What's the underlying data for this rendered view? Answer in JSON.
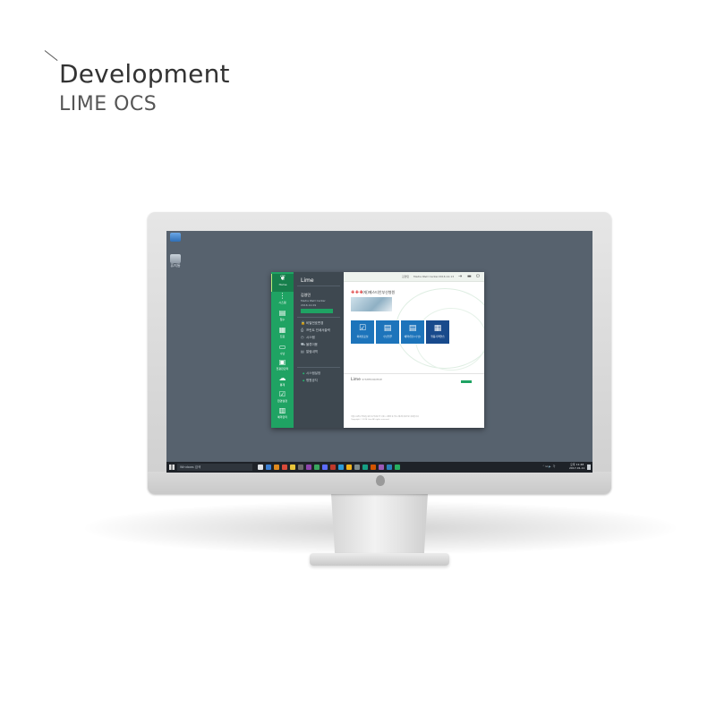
{
  "heading": {
    "title": "Development",
    "subtitle": "LIME OCS"
  },
  "desktop": {
    "icons": [
      {
        "name": "pc-icon",
        "label": ""
      },
      {
        "name": "recycle-bin-icon",
        "label": "휴지통"
      }
    ]
  },
  "app": {
    "rail": [
      {
        "icon": "leaf-icon",
        "label": "Home",
        "active": true
      },
      {
        "icon": "tree-icon",
        "label": "시스템"
      },
      {
        "icon": "clipboard-icon",
        "label": "접수"
      },
      {
        "icon": "document-icon",
        "label": "진료"
      },
      {
        "icon": "card-icon",
        "label": "수납"
      },
      {
        "icon": "monitor-icon",
        "label": "전광판관리"
      },
      {
        "icon": "cloud-icon",
        "label": "통계"
      },
      {
        "icon": "checklist-icon",
        "label": "환경설정"
      },
      {
        "icon": "calendar-icon",
        "label": "예약관리"
      }
    ],
    "sidebar": {
      "brand": "Lime",
      "user_name": "김영민",
      "user_center": "Media R&D Center",
      "user_date": "2016.12.09",
      "user_button": "",
      "menu": [
        {
          "icon": "lock-icon",
          "label": "비밀번호변경"
        },
        {
          "icon": "print-icon",
          "label": "프린트 인쇄서출력"
        },
        {
          "icon": "clock-icon",
          "label": "시스템"
        },
        {
          "icon": "truck-icon",
          "label": "물류이용"
        },
        {
          "icon": "doc-icon",
          "label": "알림내역"
        }
      ],
      "submenu": [
        {
          "label": "시스템설정"
        },
        {
          "label": "병원공지"
        }
      ]
    },
    "topbar": {
      "user": "김영민",
      "center": "Media R&D Center",
      "date": "2016.12.13",
      "buttons": [
        "logout-icon",
        "minimize-icon",
        "power-icon"
      ]
    },
    "hospital": {
      "logo": "✚✚✚",
      "name": "(재)메스티안부산병원"
    },
    "tiles": [
      {
        "icon": "check-list-icon",
        "label": "외래진료실"
      },
      {
        "icon": "clipboard-icon",
        "label": "수납업무"
      },
      {
        "icon": "clipboard-icon",
        "label": "예약(접수/수납)"
      },
      {
        "icon": "document-icon",
        "label": "행동기억연습"
      }
    ],
    "notice": {
      "title": "Lime",
      "title_small": "SYSTEM NOTICE",
      "more": "",
      "copyright_1": "서울시 송파구 전동길 동쪽 동 작년로 주 사용 / 시정된 동 주소 (재)에 사용으로 사용합니다.",
      "copyright_2": "Copyright © 2016 Lime All rights reserved."
    }
  },
  "taskbar": {
    "search_placeholder": "Windows 검색",
    "apps": [
      "#dfe3e7",
      "#3b7fd4",
      "#e08a1e",
      "#d94a3a",
      "#e8c43a",
      "#6a6a6a",
      "#8e44ad",
      "#3aa65f",
      "#5c6cff",
      "#c0392b",
      "#2d9bd8",
      "#f3b21a",
      "#7f8c8d",
      "#16a085",
      "#d35400",
      "#9b59b6",
      "#2980b9",
      "#27ae60"
    ],
    "tray": "⌃ ⊡ 🔈 가",
    "time": "오후 11:48",
    "date": "2017-01-11"
  }
}
